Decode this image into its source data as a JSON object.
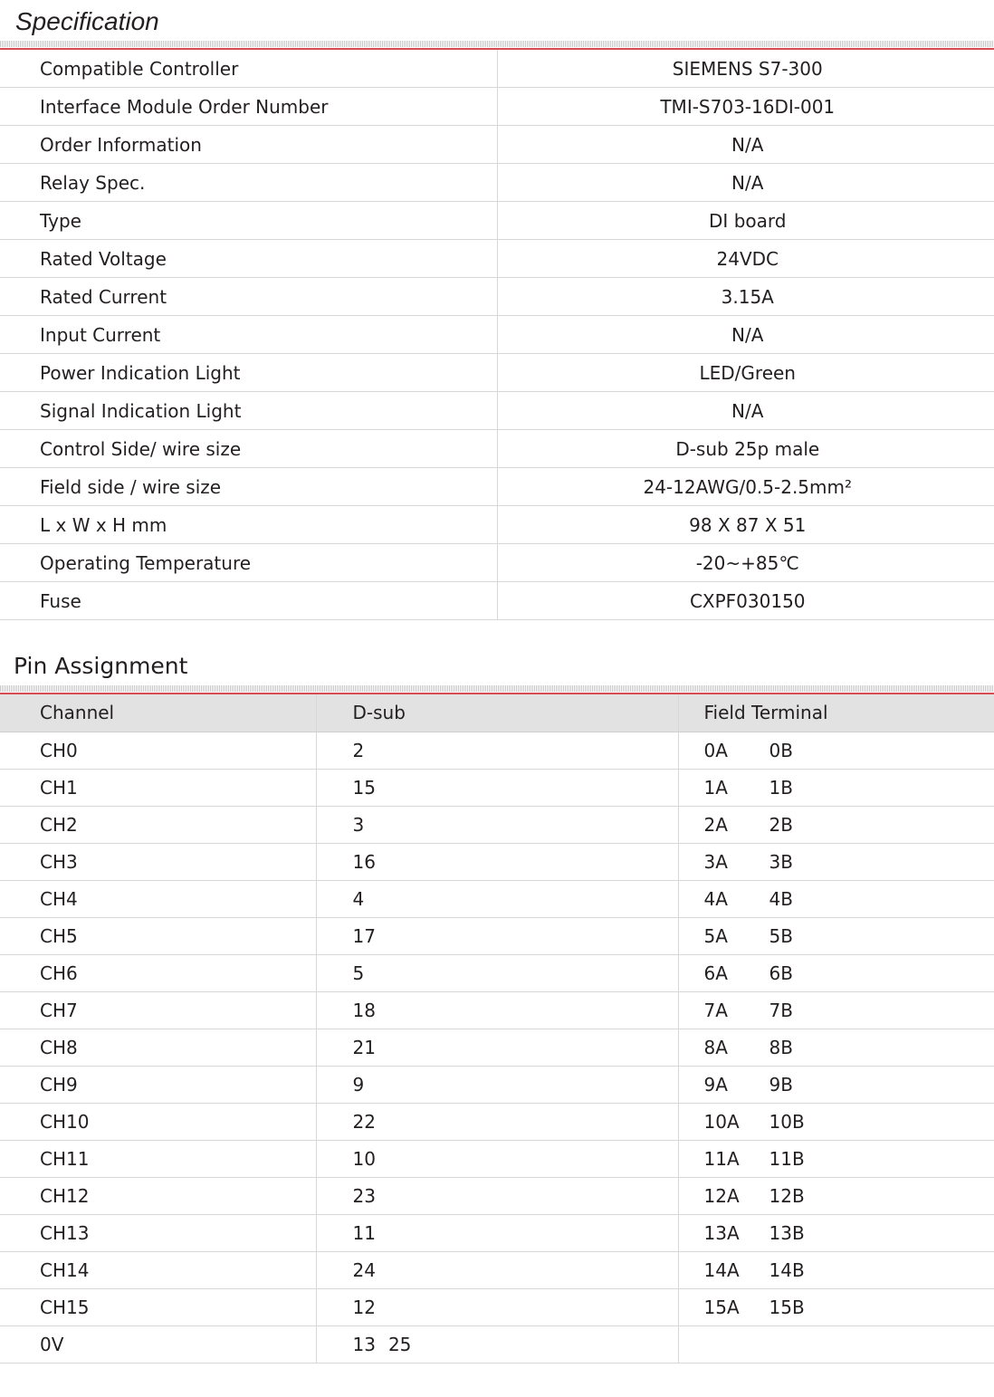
{
  "specification": {
    "title": "Specification",
    "rows": [
      {
        "label": "Compatible Controller",
        "value": "SIEMENS S7-300"
      },
      {
        "label": "Interface Module Order Number",
        "value": "TMI-S703-16DI-001"
      },
      {
        "label": "Order Information",
        "value": "N/A"
      },
      {
        "label": "Relay Spec.",
        "value": "N/A"
      },
      {
        "label": "Type",
        "value": "DI board"
      },
      {
        "label": "Rated Voltage",
        "value": "24VDC"
      },
      {
        "label": "Rated Current",
        "value": "3.15A"
      },
      {
        "label": "Input Current",
        "value": "N/A"
      },
      {
        "label": "Power Indication Light",
        "value": "LED/Green"
      },
      {
        "label": "Signal Indication Light",
        "value": "N/A"
      },
      {
        "label": "Control Side/ wire size",
        "value": "D-sub 25p male"
      },
      {
        "label": "Field side / wire size",
        "value": "24-12AWG/0.5-2.5mm²"
      },
      {
        "label": "L x W x H mm",
        "value": "98 X 87 X 51"
      },
      {
        "label": "Operating Temperature",
        "value": "-20~+85℃"
      },
      {
        "label": "Fuse",
        "value": "CXPF030150"
      }
    ]
  },
  "pin_assignment": {
    "title": "Pin Assignment",
    "headers": {
      "channel": "Channel",
      "dsub": "D-sub",
      "field": "Field  Terminal"
    },
    "rows": [
      {
        "channel": "CH0",
        "dsub": "2",
        "dsub2": "",
        "term_a": "0A",
        "term_b": "0B"
      },
      {
        "channel": "CH1",
        "dsub": "15",
        "dsub2": "",
        "term_a": "1A",
        "term_b": "1B"
      },
      {
        "channel": "CH2",
        "dsub": "3",
        "dsub2": "",
        "term_a": "2A",
        "term_b": "2B"
      },
      {
        "channel": "CH3",
        "dsub": "16",
        "dsub2": "",
        "term_a": "3A",
        "term_b": "3B"
      },
      {
        "channel": "CH4",
        "dsub": "4",
        "dsub2": "",
        "term_a": "4A",
        "term_b": "4B"
      },
      {
        "channel": "CH5",
        "dsub": "17",
        "dsub2": "",
        "term_a": "5A",
        "term_b": "5B"
      },
      {
        "channel": "CH6",
        "dsub": "5",
        "dsub2": "",
        "term_a": "6A",
        "term_b": "6B"
      },
      {
        "channel": "CH7",
        "dsub": "18",
        "dsub2": "",
        "term_a": "7A",
        "term_b": "7B"
      },
      {
        "channel": "CH8",
        "dsub": "21",
        "dsub2": "",
        "term_a": "8A",
        "term_b": "8B"
      },
      {
        "channel": "CH9",
        "dsub": "9",
        "dsub2": "",
        "term_a": "9A",
        "term_b": "9B"
      },
      {
        "channel": "CH10",
        "dsub": "22",
        "dsub2": "",
        "term_a": "10A",
        "term_b": "10B"
      },
      {
        "channel": "CH11",
        "dsub": "10",
        "dsub2": "",
        "term_a": "11A",
        "term_b": "11B"
      },
      {
        "channel": "CH12",
        "dsub": "23",
        "dsub2": "",
        "term_a": "12A",
        "term_b": "12B"
      },
      {
        "channel": "CH13",
        "dsub": "11",
        "dsub2": "",
        "term_a": "13A",
        "term_b": "13B"
      },
      {
        "channel": "CH14",
        "dsub": "24",
        "dsub2": "",
        "term_a": "14A",
        "term_b": "14B"
      },
      {
        "channel": "CH15",
        "dsub": "12",
        "dsub2": "",
        "term_a": "15A",
        "term_b": "15B"
      },
      {
        "channel": "0V",
        "dsub": "13",
        "dsub2": "25",
        "term_a": "",
        "term_b": ""
      }
    ]
  },
  "colors": {
    "accent_line": "#d94a52",
    "header_bg": "#e2e2e2",
    "grid_line": "#d7d7d7",
    "text": "#231f20"
  }
}
